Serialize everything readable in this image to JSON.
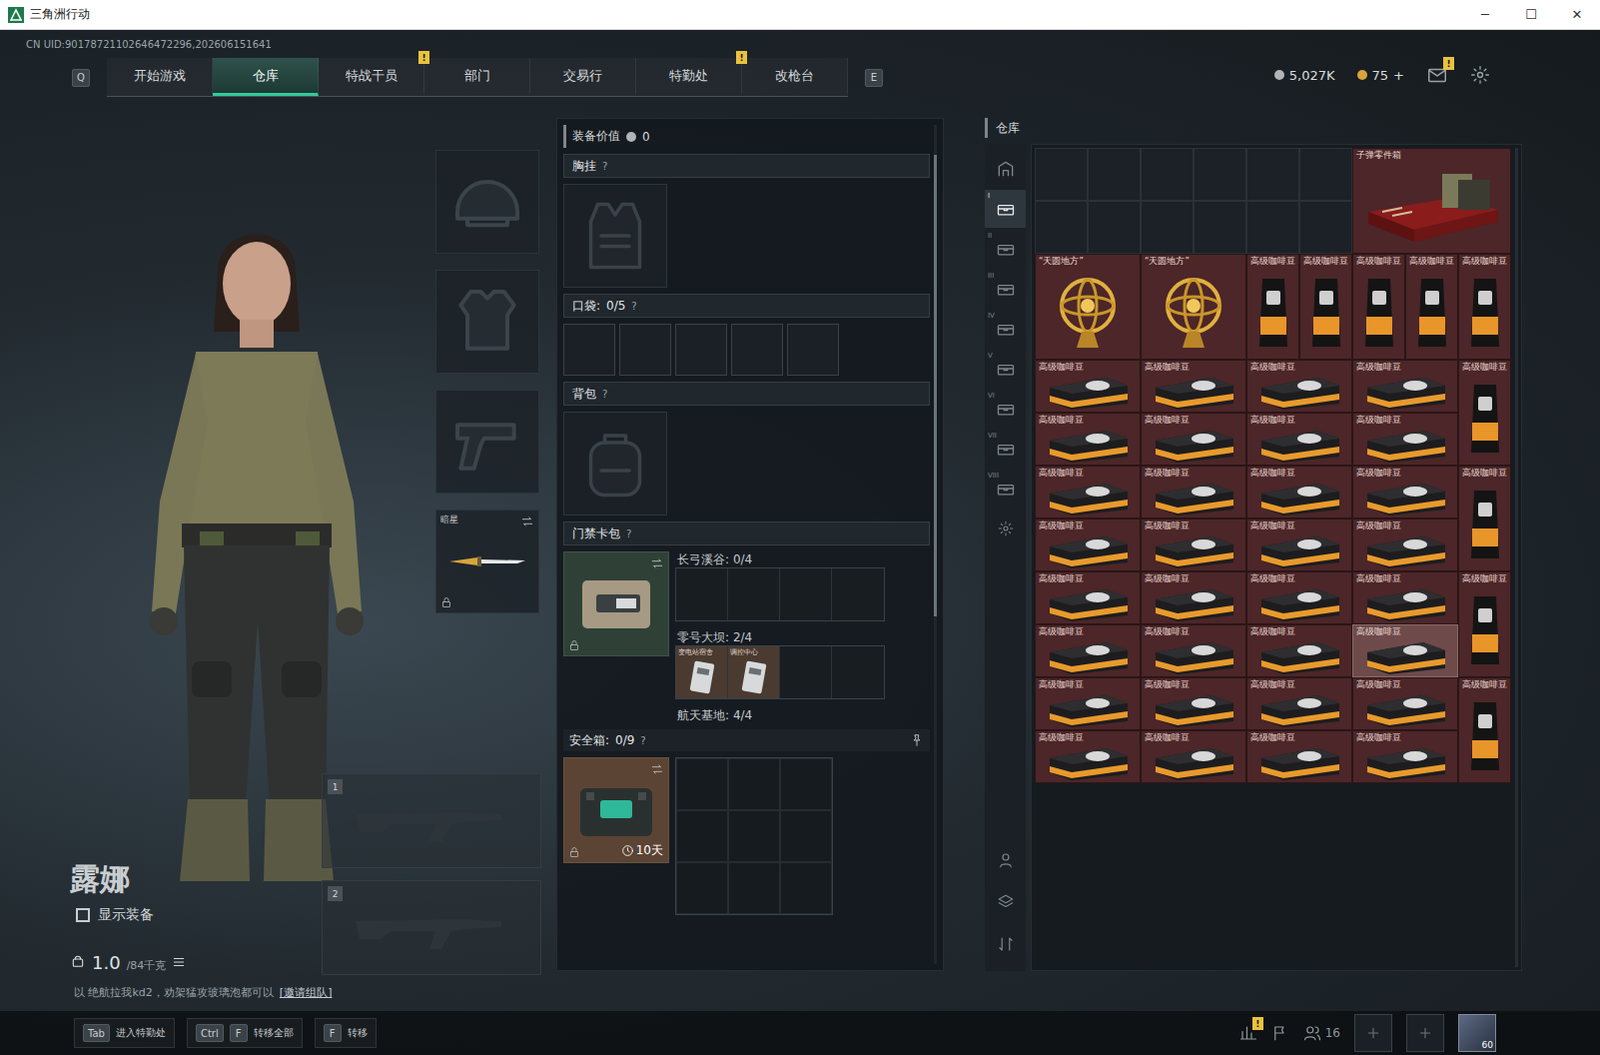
{
  "window": {
    "title": "三角洲行动",
    "controls": [
      "─",
      "☐",
      "✕"
    ]
  },
  "uid": "CN UID:90178721102646472296,202606151641",
  "nav": {
    "prev_key": "Q",
    "next_key": "E",
    "tabs": [
      {
        "label": "开始游戏",
        "selected": false,
        "badge": ""
      },
      {
        "label": "仓库",
        "selected": true,
        "badge": ""
      },
      {
        "label": "特战干员",
        "selected": false,
        "badge": "!"
      },
      {
        "label": "部门",
        "selected": false,
        "badge": ""
      },
      {
        "label": "交易行",
        "selected": false,
        "badge": ""
      },
      {
        "label": "特勤处",
        "selected": false,
        "badge": "!"
      },
      {
        "label": "改枪台",
        "selected": false,
        "badge": ""
      }
    ]
  },
  "currency": [
    {
      "kind": "silver",
      "value": "5,027K",
      "add": ""
    },
    {
      "kind": "gold",
      "value": "75",
      "add": "+"
    }
  ],
  "header_icons": [
    {
      "kind": "mail",
      "badge": "!"
    },
    {
      "kind": "settings",
      "badge": ""
    }
  ],
  "character": {
    "name": "露娜",
    "show_equipment": {
      "label": "显示装备",
      "checked": false
    },
    "weight": "1.0",
    "weight_max": "/84千克",
    "team_note": "以 绝航拉我kd2，劝架猛攻玻璃泡都可以",
    "team_link": "[邀请组队]"
  },
  "equipment_slots": [
    {
      "kind": "helmet",
      "label": "",
      "locked": false
    },
    {
      "kind": "armor",
      "label": "",
      "locked": false
    },
    {
      "kind": "pistol",
      "label": "",
      "locked": false
    },
    {
      "kind": "melee",
      "label": "暗星",
      "locked": true
    }
  ],
  "weapon_slots": [
    {
      "number": "1"
    },
    {
      "number": "2"
    }
  ],
  "loadout": {
    "value_label": "装备价值",
    "value": "0",
    "chest_rig": {
      "label": "胸挂",
      "help": "?"
    },
    "pockets": {
      "label": "口袋:",
      "count": "0/5",
      "help": "?",
      "slots": 5
    },
    "backpack": {
      "label": "背包",
      "help": "?"
    },
    "keycards": {
      "label": "门禁卡包",
      "help": "?",
      "locked": true,
      "maps": [
        {
          "name": "长弓溪谷:",
          "count": "0/4",
          "slots": 4,
          "cards": []
        },
        {
          "name": "零号大坝:",
          "count": "2/4",
          "slots": 4,
          "cards": [
            "变电站宿舍",
            "调控中心"
          ]
        },
        {
          "name": "航天基地:",
          "count": "4/4",
          "slots": 0,
          "cards": []
        }
      ]
    },
    "safe_box": {
      "label": "安全箱:",
      "count": "0/9",
      "help": "?",
      "duration": "10天",
      "locked": true,
      "slots": 9
    }
  },
  "stash": {
    "title": "仓库",
    "sidebar": [
      {
        "kind": "home",
        "label": "",
        "selected": false
      },
      {
        "kind": "tab",
        "label": "I",
        "selected": true
      },
      {
        "kind": "tab",
        "label": "II",
        "selected": false
      },
      {
        "kind": "tab",
        "label": "III",
        "selected": false
      },
      {
        "kind": "tab",
        "label": "IV",
        "selected": false
      },
      {
        "kind": "tab",
        "label": "V",
        "selected": false
      },
      {
        "kind": "tab",
        "label": "VI",
        "selected": false
      },
      {
        "kind": "tab",
        "label": "VII",
        "selected": false
      },
      {
        "kind": "tab",
        "label": "VIII",
        "selected": false
      },
      {
        "kind": "gear",
        "label": "",
        "selected": false
      }
    ],
    "sidebar_bottom": [
      {
        "kind": "operator"
      },
      {
        "kind": "layers"
      },
      {
        "kind": "sort"
      }
    ],
    "items": [
      {
        "kind": "empty",
        "name": "",
        "selected": false
      },
      {
        "kind": "empty",
        "name": "",
        "selected": false
      },
      {
        "kind": "empty",
        "name": "",
        "selected": false
      },
      {
        "kind": "empty",
        "name": "",
        "selected": false
      },
      {
        "kind": "empty",
        "name": "",
        "selected": false
      },
      {
        "kind": "empty",
        "name": "",
        "selected": false
      },
      {
        "kind": "crate",
        "name": "子弹零件箱",
        "selected": false
      },
      {
        "kind": "empty",
        "name": "",
        "selected": false
      },
      {
        "kind": "empty",
        "name": "",
        "selected": false
      },
      {
        "kind": "empty",
        "name": "",
        "selected": false
      },
      {
        "kind": "empty",
        "name": "",
        "selected": false
      },
      {
        "kind": "empty",
        "name": "",
        "selected": false
      },
      {
        "kind": "empty",
        "name": "",
        "selected": false
      },
      {
        "kind": "globe",
        "name": "“天圆地方”",
        "selected": false
      },
      {
        "kind": "globe",
        "name": "“天圆地方”",
        "selected": false
      },
      {
        "kind": "bag",
        "name": "高级咖啡豆",
        "selected": false
      },
      {
        "kind": "bag",
        "name": "高级咖啡豆",
        "selected": false
      },
      {
        "kind": "bag",
        "name": "高级咖啡豆",
        "selected": false
      },
      {
        "kind": "bag",
        "name": "高级咖啡豆",
        "selected": false
      },
      {
        "kind": "bag",
        "name": "高级咖啡豆",
        "selected": false
      },
      {
        "kind": "box",
        "name": "高级咖啡豆",
        "selected": false
      },
      {
        "kind": "box",
        "name": "高级咖啡豆",
        "selected": false
      },
      {
        "kind": "box",
        "name": "高级咖啡豆",
        "selected": false
      },
      {
        "kind": "box",
        "name": "高级咖啡豆",
        "selected": false
      },
      {
        "kind": "bag",
        "name": "高级咖啡豆",
        "selected": false
      },
      {
        "kind": "box",
        "name": "高级咖啡豆",
        "selected": false
      },
      {
        "kind": "box",
        "name": "高级咖啡豆",
        "selected": false
      },
      {
        "kind": "box",
        "name": "高级咖啡豆",
        "selected": false
      },
      {
        "kind": "box",
        "name": "高级咖啡豆",
        "selected": false
      },
      {
        "kind": "box",
        "name": "高级咖啡豆",
        "selected": false
      },
      {
        "kind": "box",
        "name": "高级咖啡豆",
        "selected": false
      },
      {
        "kind": "box",
        "name": "高级咖啡豆",
        "selected": false
      },
      {
        "kind": "box",
        "name": "高级咖啡豆",
        "selected": false
      },
      {
        "kind": "bag",
        "name": "高级咖啡豆",
        "selected": false
      },
      {
        "kind": "box",
        "name": "高级咖啡豆",
        "selected": false
      },
      {
        "kind": "box",
        "name": "高级咖啡豆",
        "selected": false
      },
      {
        "kind": "box",
        "name": "高级咖啡豆",
        "selected": false
      },
      {
        "kind": "box",
        "name": "高级咖啡豆",
        "selected": false
      },
      {
        "kind": "box",
        "name": "高级咖啡豆",
        "selected": false
      },
      {
        "kind": "box",
        "name": "高级咖啡豆",
        "selected": false
      },
      {
        "kind": "box",
        "name": "高级咖啡豆",
        "selected": false
      },
      {
        "kind": "box",
        "name": "高级咖啡豆",
        "selected": false
      },
      {
        "kind": "bag",
        "name": "高级咖啡豆",
        "selected": false
      },
      {
        "kind": "box",
        "name": "高级咖啡豆",
        "selected": false
      },
      {
        "kind": "box",
        "name": "高级咖啡豆",
        "selected": false
      },
      {
        "kind": "box",
        "name": "高级咖啡豆",
        "selected": false
      },
      {
        "kind": "box",
        "name": "高级咖啡豆",
        "selected": true
      },
      {
        "kind": "box",
        "name": "高级咖啡豆",
        "selected": false
      },
      {
        "kind": "box",
        "name": "高级咖啡豆",
        "selected": false
      },
      {
        "kind": "box",
        "name": "高级咖啡豆",
        "selected": false
      },
      {
        "kind": "box",
        "name": "高级咖啡豆",
        "selected": false
      },
      {
        "kind": "bag",
        "name": "高级咖啡豆",
        "selected": false
      },
      {
        "kind": "box",
        "name": "高级咖啡豆",
        "selected": false
      },
      {
        "kind": "box",
        "name": "高级咖啡豆",
        "selected": false
      },
      {
        "kind": "box",
        "name": "高级咖啡豆",
        "selected": false
      },
      {
        "kind": "box",
        "name": "高级咖啡豆",
        "selected": false
      }
    ]
  },
  "bottom_bar": {
    "hints": [
      {
        "keys": [
          "Tab"
        ],
        "label": "进入特勤处"
      },
      {
        "keys": [
          "Ctrl",
          "F"
        ],
        "label": "转移全部"
      },
      {
        "keys": [
          "F"
        ],
        "label": "转移"
      }
    ],
    "icons": [
      {
        "kind": "stats",
        "badge": "!",
        "text": ""
      },
      {
        "kind": "flag",
        "badge": "",
        "text": ""
      },
      {
        "kind": "friends",
        "badge": "",
        "text": "16"
      },
      {
        "kind": "add",
        "badge": "",
        "text": ""
      },
      {
        "kind": "add",
        "badge": "",
        "text": ""
      },
      {
        "kind": "avatar",
        "badge": "",
        "text": "60"
      }
    ]
  }
}
